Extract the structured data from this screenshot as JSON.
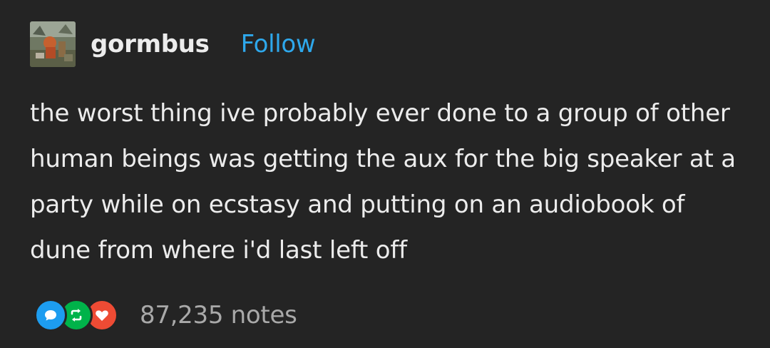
{
  "post": {
    "username": "gormbus",
    "follow_label": "Follow",
    "body": "the worst thing ive probably ever done to a group of other human beings was getting the aux for the big speaker at a party while on ecstasy and putting on an audiobook of dune from where i'd last left off",
    "notes": {
      "count_label": "87,235 notes",
      "icons": [
        {
          "name": "reply-icon",
          "color": "#1d9df0"
        },
        {
          "name": "reblog-icon",
          "color": "#00b34a"
        },
        {
          "name": "like-icon",
          "color": "#ee4b34"
        }
      ]
    }
  },
  "colors": {
    "background": "#242424",
    "text": "#ececec",
    "follow": "#2ea8ec",
    "notes_text": "#a9a9a9"
  }
}
